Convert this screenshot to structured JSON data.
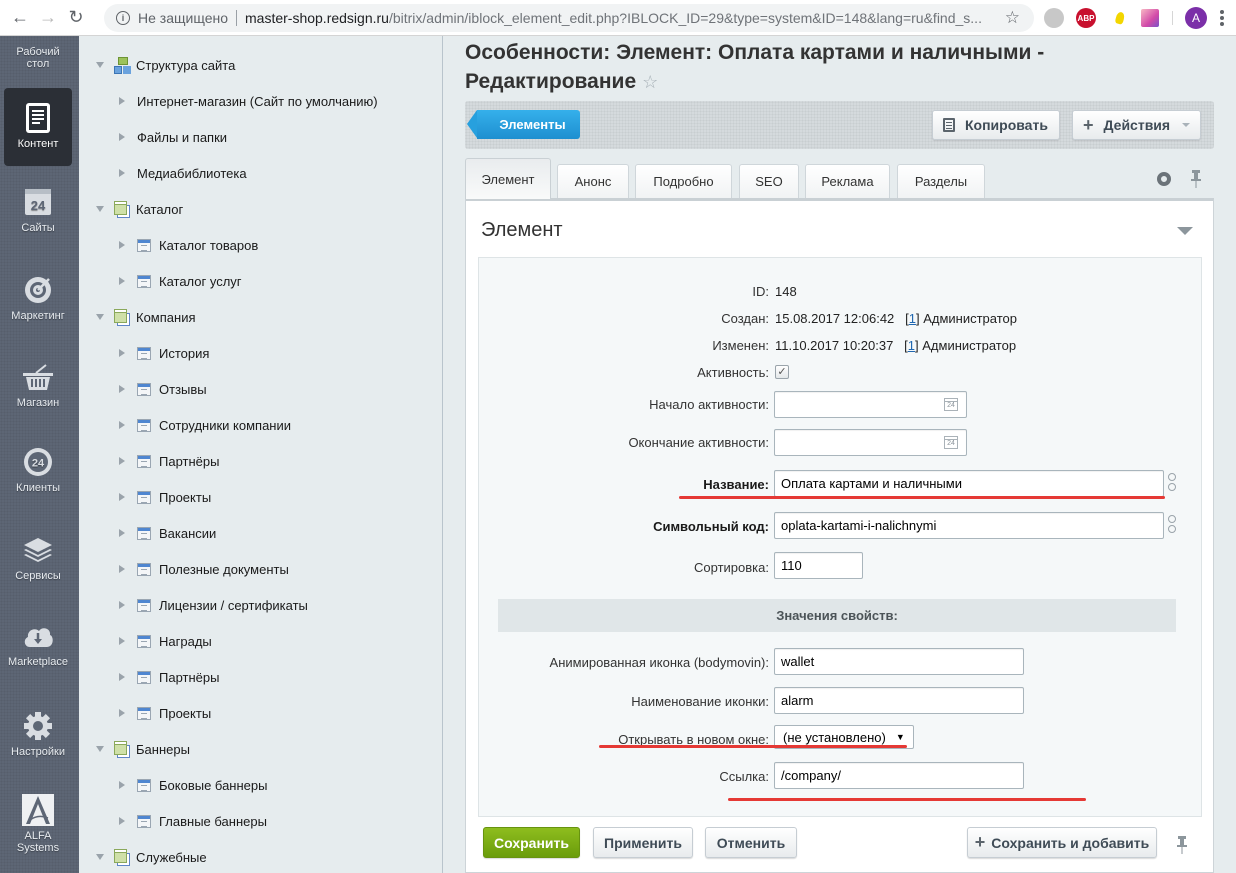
{
  "browser": {
    "security_label": "Не защищено",
    "url_host": "master-shop.redsign.ru",
    "url_path": "/bitrix/admin/iblock_element_edit.php?IBLOCK_ID=29&type=system&ID=148&lang=ru&find_s...",
    "ext_abp": "ABP",
    "profile_initial": "A"
  },
  "adminbar": {
    "items": [
      {
        "label": "Рабочий стол",
        "icon": "desktop-icon"
      },
      {
        "label": "Контент",
        "icon": "document-icon",
        "active": true
      },
      {
        "label": "Сайты",
        "icon": "calendar-24-icon",
        "badge": "24"
      },
      {
        "label": "Маркетинг",
        "icon": "target-icon"
      },
      {
        "label": "Магазин",
        "icon": "basket-icon"
      },
      {
        "label": "Клиенты",
        "icon": "crm-24-icon",
        "badge": "24"
      },
      {
        "label": "Сервисы",
        "icon": "layers-icon"
      },
      {
        "label": "Marketplace",
        "icon": "cloud-download-icon"
      },
      {
        "label": "Настройки",
        "icon": "gear-icon"
      },
      {
        "label": "ALFA Systems",
        "icon": "alfa-logo-icon"
      }
    ]
  },
  "tree": {
    "items": [
      {
        "label": "Структура сайта",
        "level": 0,
        "icon": "structure-icon",
        "expanded": true
      },
      {
        "label": "Интернет-магазин (Сайт по умолчанию)",
        "level": 1,
        "icon": "none"
      },
      {
        "label": "Файлы и папки",
        "level": 1,
        "icon": "none"
      },
      {
        "label": "Медиабиблиотека",
        "level": 1,
        "icon": "none"
      },
      {
        "label": "Каталог",
        "level": 0,
        "icon": "section-icon",
        "expanded": true
      },
      {
        "label": "Каталог товаров",
        "level": 1,
        "icon": "iblock-icon"
      },
      {
        "label": "Каталог услуг",
        "level": 1,
        "icon": "iblock-icon"
      },
      {
        "label": "Компания",
        "level": 0,
        "icon": "section-icon",
        "expanded": true
      },
      {
        "label": "История",
        "level": 1,
        "icon": "iblock-icon"
      },
      {
        "label": "Отзывы",
        "level": 1,
        "icon": "iblock-icon"
      },
      {
        "label": "Сотрудники компании",
        "level": 1,
        "icon": "iblock-icon"
      },
      {
        "label": "Партнёры",
        "level": 1,
        "icon": "iblock-icon"
      },
      {
        "label": "Проекты",
        "level": 1,
        "icon": "iblock-icon"
      },
      {
        "label": "Вакансии",
        "level": 1,
        "icon": "iblock-icon"
      },
      {
        "label": "Полезные документы",
        "level": 1,
        "icon": "iblock-icon"
      },
      {
        "label": "Лицензии / сертификаты",
        "level": 1,
        "icon": "iblock-icon"
      },
      {
        "label": "Награды",
        "level": 1,
        "icon": "iblock-icon"
      },
      {
        "label": "Партнёры",
        "level": 1,
        "icon": "iblock-icon"
      },
      {
        "label": "Проекты",
        "level": 1,
        "icon": "iblock-icon"
      },
      {
        "label": "Баннеры",
        "level": 0,
        "icon": "section-icon",
        "expanded": true
      },
      {
        "label": "Боковые баннеры",
        "level": 1,
        "icon": "iblock-icon"
      },
      {
        "label": "Главные баннеры",
        "level": 1,
        "icon": "iblock-icon"
      },
      {
        "label": "Служебные",
        "level": 0,
        "icon": "section-icon",
        "expanded": true
      }
    ]
  },
  "page": {
    "title": "Особенности: Элемент: Оплата картами и наличными - Редактирование",
    "toolbar": {
      "back_label": "Элементы",
      "copy_label": "Копировать",
      "actions_label": "Действия"
    },
    "tabs": [
      {
        "label": "Элемент",
        "active": true
      },
      {
        "label": "Анонс"
      },
      {
        "label": "Подробно"
      },
      {
        "label": "SEO"
      },
      {
        "label": "Реклама"
      },
      {
        "label": "Разделы"
      }
    ],
    "panel_title": "Элемент",
    "fields": {
      "id_label": "ID:",
      "id_value": "148",
      "created_label": "Создан:",
      "created_value": "15.08.2017 12:06:42",
      "created_user_id": "1",
      "created_user": "Администратор",
      "modified_label": "Изменен:",
      "modified_value": "11.10.2017 10:20:37",
      "modified_user_id": "1",
      "modified_user": "Администратор",
      "active_label": "Активность:",
      "active_checked": true,
      "active_from_label": "Начало активности:",
      "active_from_value": "",
      "active_to_label": "Окончание активности:",
      "active_to_value": "",
      "name_label": "Название:",
      "name_value": "Оплата картами и наличными",
      "code_label": "Символьный код:",
      "code_value": "oplata-kartami-i-nalichnymi",
      "sort_label": "Сортировка:",
      "sort_value": "110"
    },
    "properties": {
      "header": "Значения свойств:",
      "anim_icon_label": "Анимированная иконка (bodymovin):",
      "anim_icon_value": "wallet",
      "icon_name_label": "Наименование иконки:",
      "icon_name_value": "alarm",
      "new_window_label": "Открывать в новом окне:",
      "new_window_value": "(не установлено)",
      "link_label": "Ссылка:",
      "link_value": "/company/"
    },
    "footer": {
      "save_label": "Сохранить",
      "apply_label": "Применить",
      "cancel_label": "Отменить",
      "save_add_label": "Сохранить и добавить"
    },
    "colors": {
      "accent_blue": "#1e8fd0",
      "save_green": "#7aab14",
      "annotation_red": "#e53935"
    }
  }
}
